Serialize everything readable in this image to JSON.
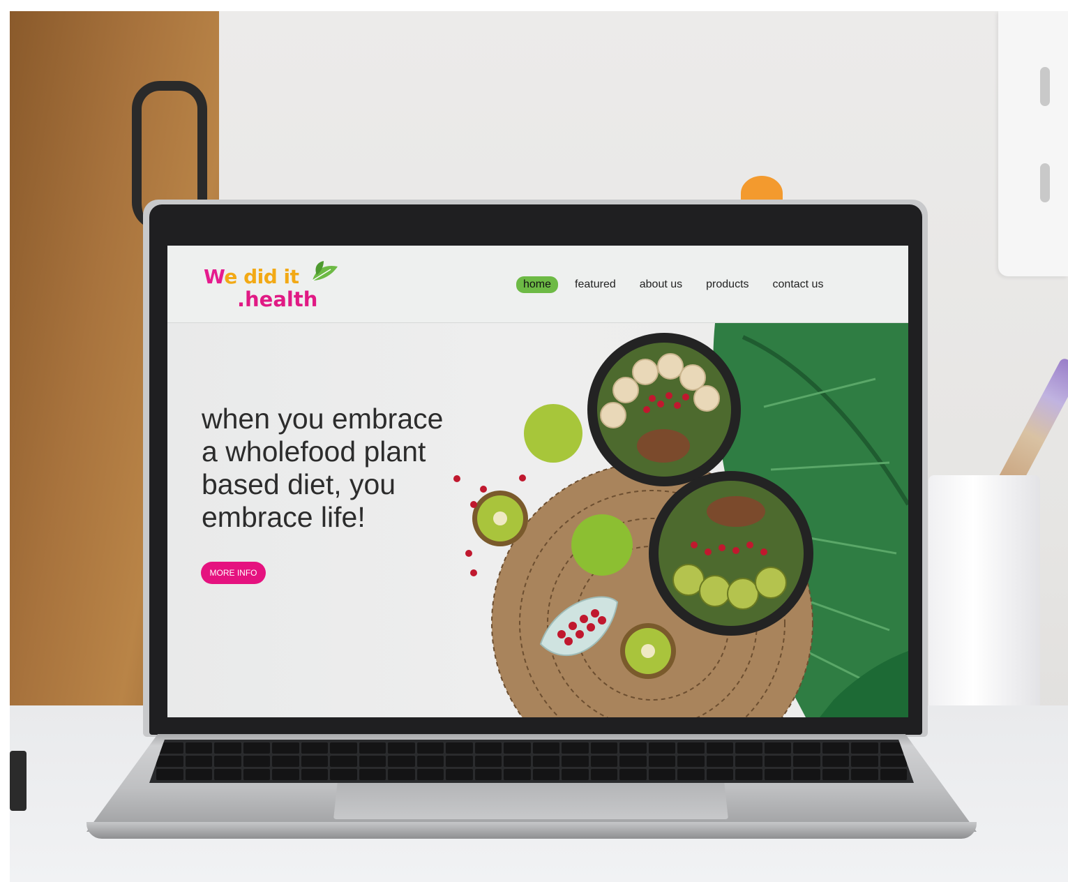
{
  "site": {
    "logo": {
      "line1_w": "W",
      "line1_rest": "e did it",
      "line2": ".health"
    },
    "nav": {
      "items": [
        {
          "label": "home",
          "active": true
        },
        {
          "label": "featured",
          "active": false
        },
        {
          "label": "about us",
          "active": false
        },
        {
          "label": "products",
          "active": false
        },
        {
          "label": "contact us",
          "active": false
        }
      ]
    },
    "hero": {
      "title": "when you embrace a wholefood plant based diet, you embrace life!",
      "button_label": "MORE INFO"
    }
  },
  "colors": {
    "accent_green": "#6dba45",
    "brand_pink": "#e5127f",
    "brand_orange": "#f2a915",
    "header_bg": "#eef0ef"
  }
}
